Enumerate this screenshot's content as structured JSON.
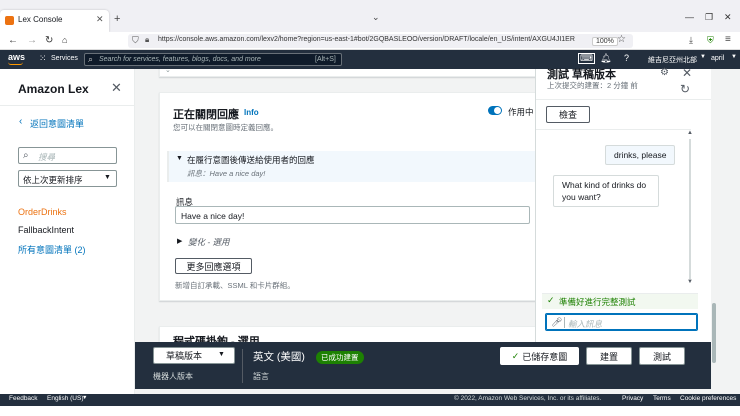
{
  "browser": {
    "tab_title": "Lex Console",
    "url": "https://console.aws.amazon.com/lexv2/home?region=us-east-1#bot/2GQBASLEOO/version/DRAFT/locale/en_US/intent/AXGU4JI1ER",
    "zoom": "100%"
  },
  "aws_nav": {
    "logo": "aws",
    "services_label": "Services",
    "search_placeholder": "Search for services, features, blogs, docs, and more",
    "search_shortcut": "[Alt+S]",
    "region": "維吉尼亞州北部",
    "user": "april"
  },
  "sidebar": {
    "title": "Amazon Lex",
    "back_link": "返回意圖清單",
    "search_placeholder": "搜尋",
    "sort_value": "依上次更新排序",
    "items": [
      {
        "label": "OrderDrinks"
      },
      {
        "label": "FallbackIntent"
      },
      {
        "label": "所有意圖清單 (2)"
      }
    ]
  },
  "closing_response": {
    "title": "正在關閉回應",
    "info": "Info",
    "description": "您可以在關閉意圖時定義回應。",
    "toggle_label": "作用中",
    "expander_title": "在履行意圖後傳送給使用者的回應",
    "expander_subtitle": "訊息：Have a nice day!",
    "message_label": "訊息",
    "message_value": "Have a nice day!",
    "variations": "變化 - 選用",
    "more_options_button": "更多回應選項",
    "hint": "新增自訂承載、SSML 和卡片群組。"
  },
  "next_card": {
    "title": "程式碼掛鉤 - 選用"
  },
  "test_panel": {
    "title": "測試 草稿版本",
    "subtitle": "上次提交的建置：2 分鐘 前",
    "inspect_button": "檢查",
    "messages": [
      {
        "from": "user",
        "text": "drinks, please"
      },
      {
        "from": "bot",
        "text": "What kind of drinks do you want?"
      }
    ],
    "status": "準備好進行完整測試",
    "input_placeholder": "輸入訊息"
  },
  "bottom_bar": {
    "version_select": "草稿版本",
    "version_label": "機器人版本",
    "language": "英文 (美國)",
    "language_badge": "已成功建置",
    "language_label": "語言",
    "saved_button": "已儲存意圖",
    "build_button": "建置",
    "test_button": "測試"
  },
  "footer": {
    "feedback": "Feedback",
    "language": "English (US)",
    "copyright": "© 2022, Amazon Web Services, Inc. or its affiliates.",
    "privacy": "Privacy",
    "terms": "Terms",
    "cookies": "Cookie preferences"
  },
  "colors": {
    "aws_dark": "#232f3e",
    "link_blue": "#0073bb",
    "orange": "#ec7211",
    "green": "#1d8102",
    "toggle_blue": "#0073bb"
  }
}
